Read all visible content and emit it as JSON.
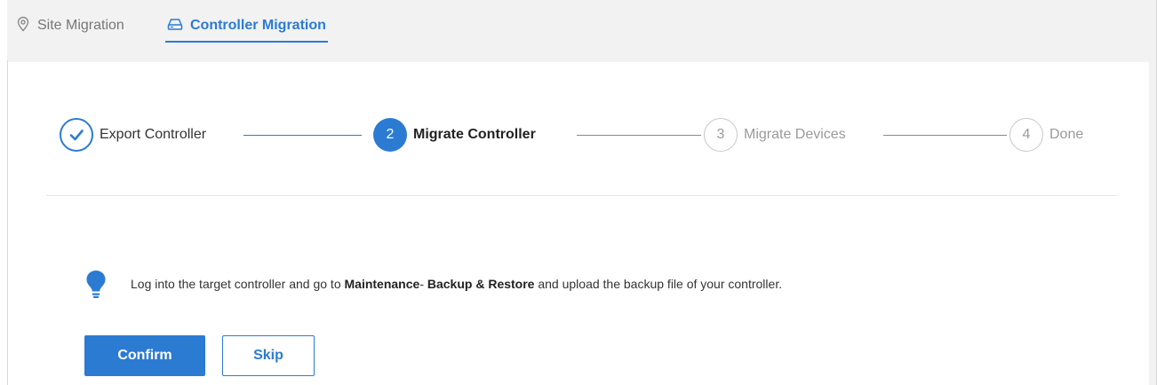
{
  "tabs": {
    "site_migration": "Site Migration",
    "controller_migration": "Controller Migration"
  },
  "steps": [
    {
      "number": "",
      "label": "Export Controller",
      "state": "done"
    },
    {
      "number": "2",
      "label": "Migrate Controller",
      "state": "active"
    },
    {
      "number": "3",
      "label": "Migrate Devices",
      "state": "pending"
    },
    {
      "number": "4",
      "label": "Done",
      "state": "pending"
    }
  ],
  "notice": {
    "prefix": "Log into the target controller and go to ",
    "bold1": "Maintenance",
    "middle": "- ",
    "bold2": "Backup & Restore",
    "suffix": " and upload the backup file of your controller."
  },
  "buttons": {
    "confirm": "Confirm",
    "skip": "Skip"
  },
  "colors": {
    "accent": "#2b7bd3",
    "pending": "#9a9a9a",
    "background": "#f2f2f2"
  },
  "icons": {
    "site_tab": "location-pin-icon",
    "controller_tab": "controller-icon",
    "step1": "check-icon",
    "notice": "lightbulb-icon"
  }
}
